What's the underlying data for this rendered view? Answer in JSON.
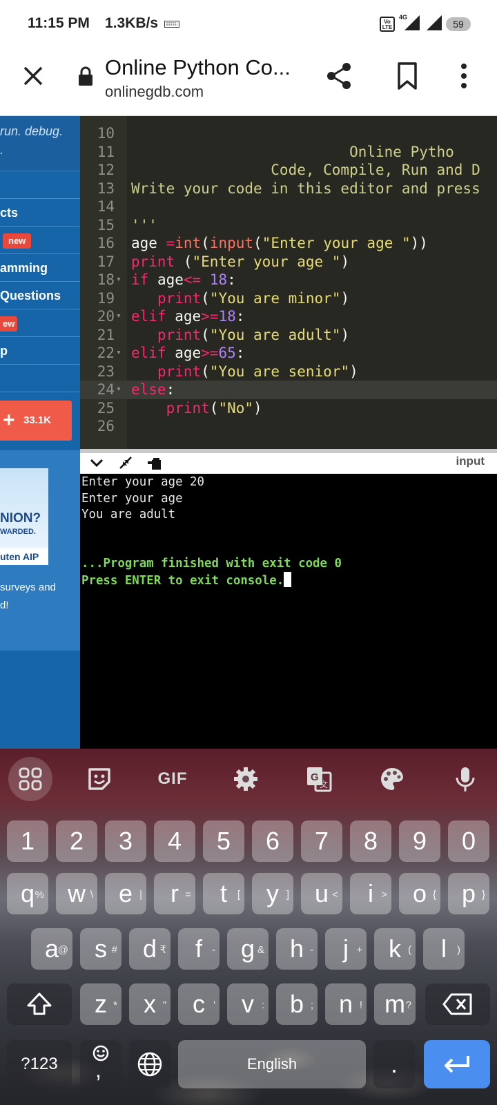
{
  "status_bar": {
    "time": "11:15 PM",
    "speed": "1.3KB/s",
    "volte": "Vo LTE",
    "network": "4G",
    "battery": "59"
  },
  "browser": {
    "title": "Online Python Co...",
    "domain": "onlinegdb.com",
    "icons": [
      "close-icon",
      "lock-icon",
      "share-icon",
      "bookmark-icon",
      "more-vert-icon"
    ]
  },
  "sidebar": {
    "tagline_line1": "run. debug.",
    "tagline_line2": ".",
    "items": [
      {
        "label": ""
      },
      {
        "label": "cts"
      },
      {
        "label": "",
        "badge": "new"
      },
      {
        "label": "amming"
      },
      {
        "label": "Questions"
      },
      {
        "label": "",
        "badge": "ew"
      },
      {
        "label": "p"
      },
      {
        "label": ""
      }
    ],
    "follow_count": "33.1K",
    "ad": {
      "question": "NION?",
      "rewarded": "WARDED.",
      "brand": "uten AIP",
      "text_line1": "surveys and",
      "text_line2": "d!"
    }
  },
  "editor": {
    "lines": [
      {
        "n": "10",
        "fold": "",
        "segments": []
      },
      {
        "n": "11",
        "fold": "",
        "segments": [
          {
            "c": "cm",
            "t": "                         Online Pytho"
          }
        ]
      },
      {
        "n": "12",
        "fold": "",
        "segments": [
          {
            "c": "cm",
            "t": "                Code, Compile, Run and D"
          }
        ]
      },
      {
        "n": "13",
        "fold": "",
        "segments": [
          {
            "c": "cm",
            "t": "Write your code in this editor and press"
          }
        ]
      },
      {
        "n": "14",
        "fold": "",
        "segments": []
      },
      {
        "n": "15",
        "fold": "",
        "segments": [
          {
            "c": "cm",
            "t": "'''"
          }
        ]
      },
      {
        "n": "16",
        "fold": "",
        "segments": [
          {
            "c": "",
            "t": "age "
          },
          {
            "c": "kw",
            "t": "="
          },
          {
            "c": "inp",
            "t": "int"
          },
          {
            "c": "",
            "t": "("
          },
          {
            "c": "inp",
            "t": "input"
          },
          {
            "c": "",
            "t": "("
          },
          {
            "c": "str",
            "t": "\"Enter your age \""
          },
          {
            "c": "",
            "t": "))"
          }
        ]
      },
      {
        "n": "17",
        "fold": "",
        "segments": [
          {
            "c": "kw",
            "t": "print"
          },
          {
            "c": "",
            "t": " ("
          },
          {
            "c": "str",
            "t": "\"Enter your age \""
          },
          {
            "c": "",
            "t": ")"
          }
        ]
      },
      {
        "n": "18",
        "fold": "▾",
        "segments": [
          {
            "c": "kw",
            "t": "if"
          },
          {
            "c": "",
            "t": " age"
          },
          {
            "c": "kw",
            "t": "<="
          },
          {
            "c": "",
            "t": " "
          },
          {
            "c": "num",
            "t": "18"
          },
          {
            "c": "",
            "t": ":"
          }
        ]
      },
      {
        "n": "19",
        "fold": "",
        "segments": [
          {
            "c": "",
            "t": "   "
          },
          {
            "c": "kw",
            "t": "print"
          },
          {
            "c": "",
            "t": "("
          },
          {
            "c": "str",
            "t": "\"You are minor\""
          },
          {
            "c": "",
            "t": ")"
          }
        ]
      },
      {
        "n": "20",
        "fold": "▾",
        "segments": [
          {
            "c": "kw",
            "t": "elif"
          },
          {
            "c": "",
            "t": " age"
          },
          {
            "c": "kw",
            "t": ">="
          },
          {
            "c": "num",
            "t": "18"
          },
          {
            "c": "",
            "t": ":"
          }
        ]
      },
      {
        "n": "21",
        "fold": "",
        "segments": [
          {
            "c": "",
            "t": "   "
          },
          {
            "c": "kw",
            "t": "print"
          },
          {
            "c": "",
            "t": "("
          },
          {
            "c": "str",
            "t": "\"You are adult\""
          },
          {
            "c": "",
            "t": ")"
          }
        ]
      },
      {
        "n": "22",
        "fold": "▾",
        "segments": [
          {
            "c": "kw",
            "t": "elif"
          },
          {
            "c": "",
            "t": " age"
          },
          {
            "c": "kw",
            "t": ">="
          },
          {
            "c": "num",
            "t": "65"
          },
          {
            "c": "",
            "t": ":"
          }
        ]
      },
      {
        "n": "23",
        "fold": "",
        "segments": [
          {
            "c": "",
            "t": "   "
          },
          {
            "c": "kw",
            "t": "print"
          },
          {
            "c": "",
            "t": "("
          },
          {
            "c": "str",
            "t": "\"You are senior\""
          },
          {
            "c": "",
            "t": ")"
          }
        ]
      },
      {
        "n": "24",
        "fold": "▾",
        "active": true,
        "segments": [
          {
            "c": "kw",
            "t": "else"
          },
          {
            "c": "",
            "t": ":"
          }
        ]
      },
      {
        "n": "25",
        "fold": "",
        "segments": [
          {
            "c": "",
            "t": "    "
          },
          {
            "c": "kw",
            "t": "print"
          },
          {
            "c": "",
            "t": "("
          },
          {
            "c": "str",
            "t": "\"No\""
          },
          {
            "c": "",
            "t": ")"
          }
        ]
      },
      {
        "n": "26",
        "fold": "",
        "segments": []
      }
    ]
  },
  "output": {
    "input_label": "input",
    "lines": [
      {
        "style": "plain",
        "text": "Enter your age 20"
      },
      {
        "style": "plain",
        "text": "Enter your age"
      },
      {
        "style": "plain",
        "text": "You are adult"
      },
      {
        "style": "plain",
        "text": ""
      },
      {
        "style": "plain",
        "text": ""
      },
      {
        "style": "green",
        "text": "...Program finished with exit code 0"
      },
      {
        "style": "green",
        "text": "Press ENTER to exit console."
      }
    ]
  },
  "keyboard": {
    "toolbar": [
      "apps-icon",
      "sticker-icon",
      "GIF",
      "settings-icon",
      "translate-icon",
      "palette-icon",
      "mic-icon"
    ],
    "gif_label": "GIF",
    "row_numbers": [
      "1",
      "2",
      "3",
      "4",
      "5",
      "6",
      "7",
      "8",
      "9",
      "0"
    ],
    "row1": [
      {
        "k": "q",
        "h": "%"
      },
      {
        "k": "w",
        "h": "\\"
      },
      {
        "k": "e",
        "h": "|"
      },
      {
        "k": "r",
        "h": "="
      },
      {
        "k": "t",
        "h": "["
      },
      {
        "k": "y",
        "h": "]"
      },
      {
        "k": "u",
        "h": "<"
      },
      {
        "k": "i",
        "h": ">"
      },
      {
        "k": "o",
        "h": "{"
      },
      {
        "k": "p",
        "h": "}"
      }
    ],
    "row2": [
      {
        "k": "a",
        "h": "@"
      },
      {
        "k": "s",
        "h": "#"
      },
      {
        "k": "d",
        "h": "₹"
      },
      {
        "k": "f",
        "h": "-"
      },
      {
        "k": "g",
        "h": "&"
      },
      {
        "k": "h",
        "h": "-"
      },
      {
        "k": "j",
        "h": "+"
      },
      {
        "k": "k",
        "h": "("
      },
      {
        "k": "l",
        "h": ")"
      }
    ],
    "row3": [
      {
        "k": "z",
        "h": "*"
      },
      {
        "k": "x",
        "h": "\""
      },
      {
        "k": "c",
        "h": "'"
      },
      {
        "k": "v",
        "h": ":"
      },
      {
        "k": "b",
        "h": ";"
      },
      {
        "k": "n",
        "h": "!"
      },
      {
        "k": "m",
        "h": "?"
      }
    ],
    "symbols_label": "?123",
    "comma": ",",
    "space_label": "English",
    "period": "."
  }
}
